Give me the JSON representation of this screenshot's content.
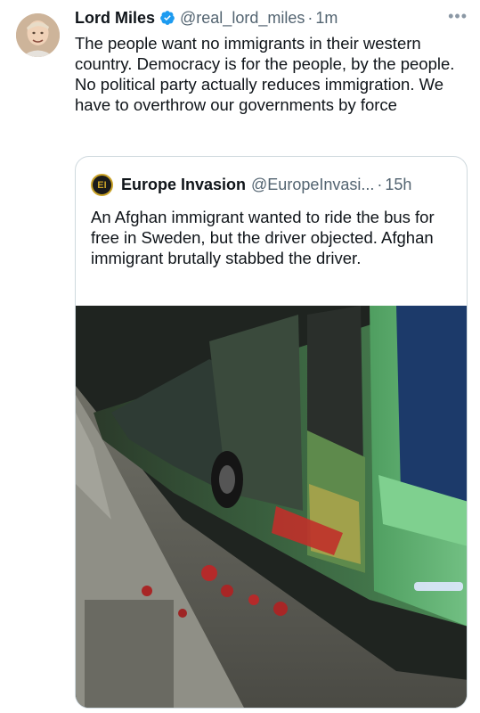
{
  "tweet": {
    "author_name": "Lord Miles",
    "author_handle": "@real_lord_miles",
    "separator": "·",
    "time": "1m",
    "more_label": "•••",
    "text": "The people want no immigrants in their western country. Democracy is for the people, by the people. No political party actually reduces immigration. We have to overthrow our governments by force",
    "avatar_icon": "user-avatar",
    "verified_color": "#1d9bf0"
  },
  "quoted": {
    "avatar_text": "EI",
    "author_name": "Europe Invasion",
    "author_handle": "@EuropeInvasi...",
    "separator": "·",
    "time": "15h",
    "text": "An Afghan immigrant wanted to ride the bus for free in Sweden, but the driver objected. Afghan immigrant brutally stabbed the driver.",
    "image_icon": "photo-bus-at-stop"
  }
}
